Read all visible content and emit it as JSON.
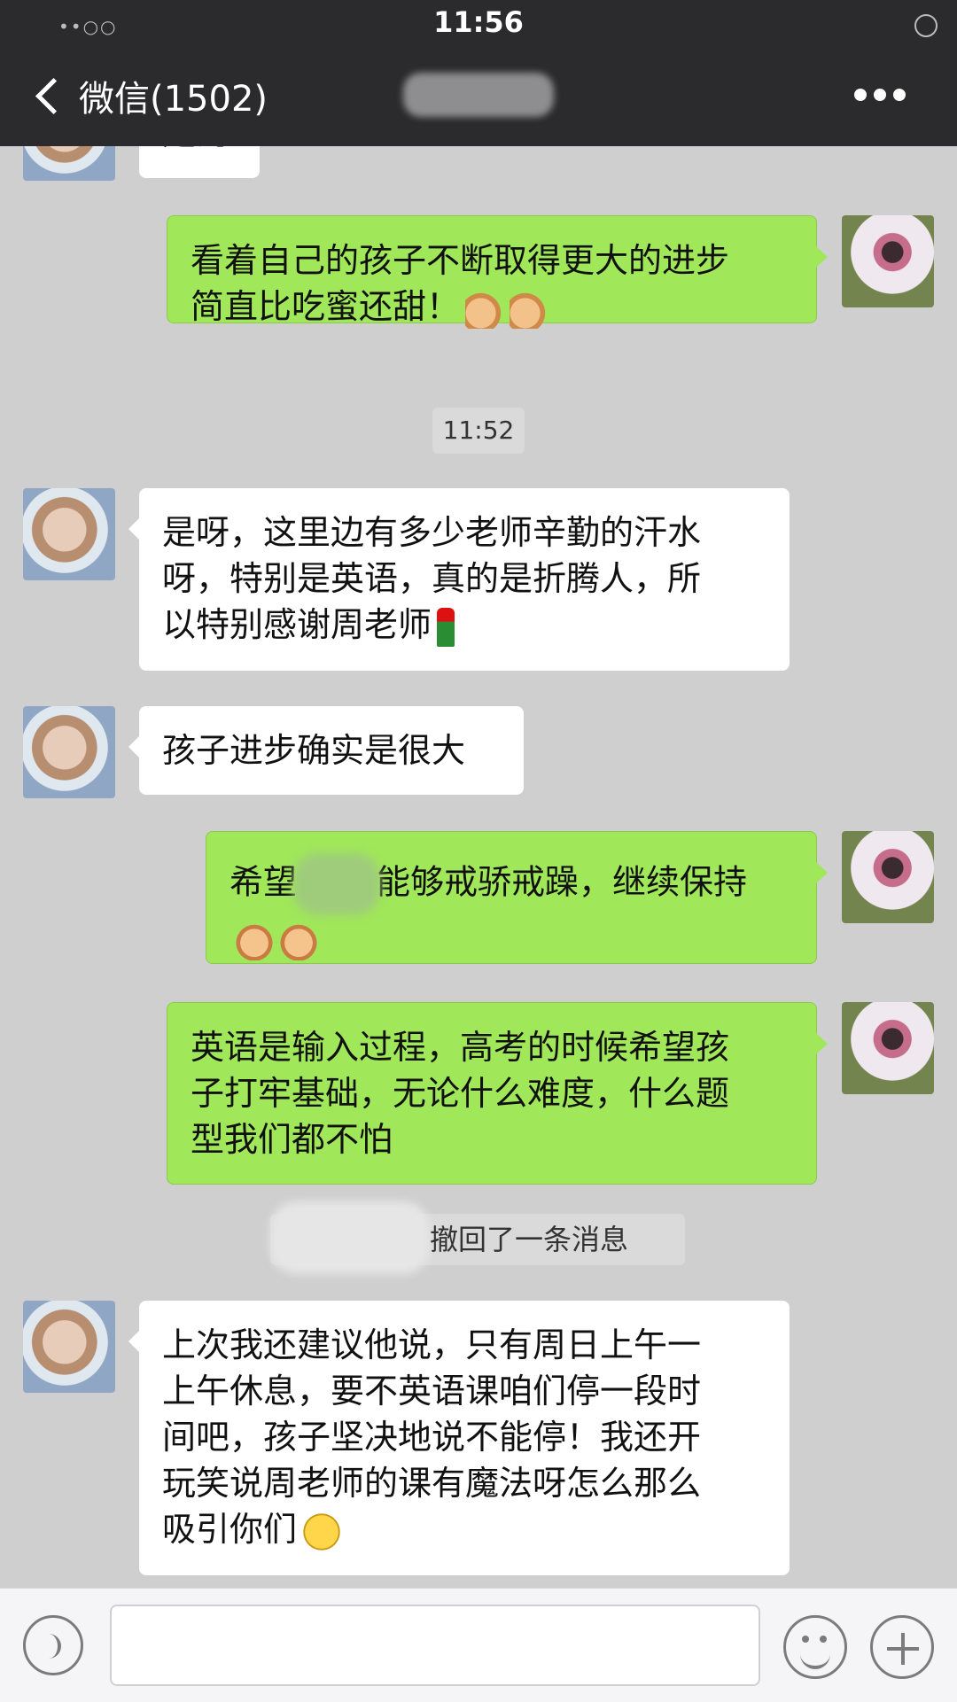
{
  "status_bar": {
    "time": "11:56",
    "signal": "••○○"
  },
  "nav": {
    "back_label": "微信(1502)"
  },
  "chat": {
    "top_partial_text": "是的",
    "msg1": {
      "line1": "看着自己的孩子不断取得更大的进步",
      "line2": "简直比吃蜜还甜！"
    },
    "timestamp": "11:52",
    "msg2": {
      "line1": "是呀，这里边有多少老师辛勤的汗水",
      "line2": "呀，特别是英语，真的是折腾人，所",
      "line3": "以特别感谢周老师"
    },
    "msg3": {
      "text": "孩子进步确实是很大"
    },
    "msg4": {
      "prefix": "希望",
      "suffix": "能够戒骄戒躁，继续保持"
    },
    "msg5": {
      "line1": "英语是输入过程，高考的时候希望孩",
      "line2": "子打牢基础，无论什么难度，什么题",
      "line3": "型我们都不怕"
    },
    "recall_notice": "撤回了一条消息",
    "msg6": {
      "line1": "上次我还建议他说，只有周日上午一",
      "line2": "上午休息，要不英语课咱们停一段时",
      "line3": "间吧，孩子坚决地说不能停！我还开",
      "line4": "玩笑说周老师的课有魔法呀怎么那么",
      "line5": "吸引你们"
    }
  },
  "icons": {
    "thumbs_up": "thumbs-up-icon",
    "fist": "raised-fist-icon",
    "rose": "rose-icon",
    "grin": "grinning-face-icon"
  },
  "colors": {
    "header_bg": "#2b2b2d",
    "chat_bg": "#cfcfcf",
    "sent_bubble": "#a0e75a",
    "recv_bubble": "#ffffff"
  }
}
